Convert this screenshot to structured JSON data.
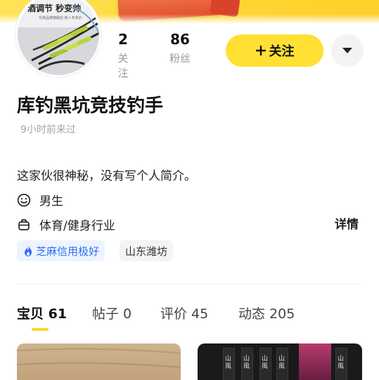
{
  "banner": {
    "avatar_line1": "酒调节 秒变帅",
    "avatar_line2": "乐高品牌旗舰店 新人专享价"
  },
  "stats": [
    {
      "value": "2",
      "label": "关注"
    },
    {
      "value": "86",
      "label": "粉丝"
    }
  ],
  "actions": {
    "follow_label": "关注",
    "more_icon": "chevron-down-icon"
  },
  "profile": {
    "name": "库钓黑坑竞技钓手",
    "last_seen": "9小时前来过",
    "bio": "这家伙很神秘，没有写个人简介。",
    "gender": "男生",
    "industry": "体育/健身行业",
    "details_label": "详情"
  },
  "tags": {
    "credit": "芝麻信用极好",
    "location": "山东潍坊"
  },
  "tabs": [
    {
      "label": "宝贝 61",
      "active": true
    },
    {
      "label": "帖子 0",
      "active": false
    },
    {
      "label": "评价 45",
      "active": false
    },
    {
      "label": "动态 205",
      "active": false
    }
  ],
  "cards": {
    "right_book_text": "山風"
  },
  "colors": {
    "accent_yellow": "#FFE033",
    "credit_blue": "#2F6FF2",
    "muted_text": "#9A9A9A"
  }
}
